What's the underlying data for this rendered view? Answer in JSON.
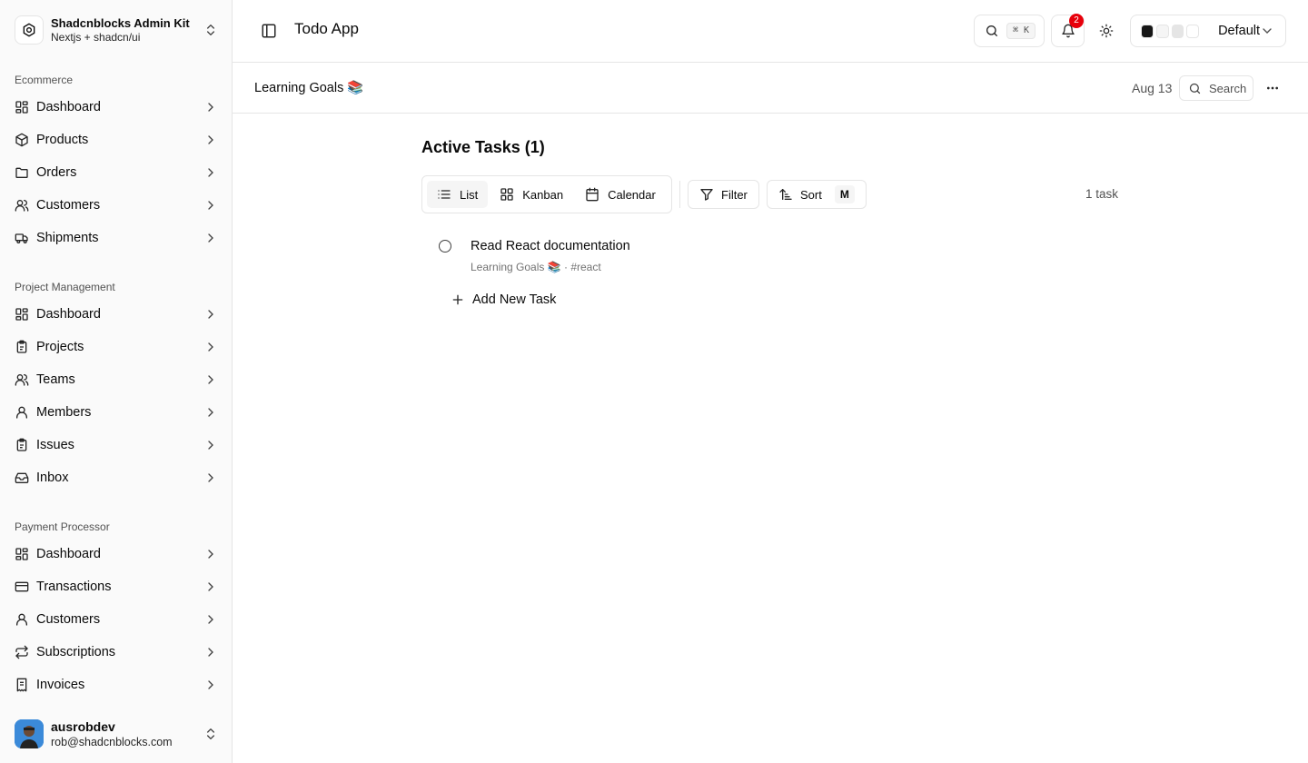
{
  "brand": {
    "name": "Shadcnblocks Admin Kit",
    "subtitle": "Nextjs + shadcn/ui"
  },
  "sidebar": {
    "groups": [
      {
        "title": "Ecommerce",
        "items": [
          {
            "label": "Dashboard",
            "icon": "dashboard-icon"
          },
          {
            "label": "Products",
            "icon": "package-icon"
          },
          {
            "label": "Orders",
            "icon": "folder-icon"
          },
          {
            "label": "Customers",
            "icon": "users-icon"
          },
          {
            "label": "Shipments",
            "icon": "truck-icon"
          }
        ]
      },
      {
        "title": "Project Management",
        "items": [
          {
            "label": "Dashboard",
            "icon": "dashboard-icon"
          },
          {
            "label": "Projects",
            "icon": "clipboard-icon"
          },
          {
            "label": "Teams",
            "icon": "users-icon"
          },
          {
            "label": "Members",
            "icon": "user-icon"
          },
          {
            "label": "Issues",
            "icon": "clipboard-icon"
          },
          {
            "label": "Inbox",
            "icon": "inbox-icon"
          }
        ]
      },
      {
        "title": "Payment Processor",
        "items": [
          {
            "label": "Dashboard",
            "icon": "dashboard-icon"
          },
          {
            "label": "Transactions",
            "icon": "credit-card-icon"
          },
          {
            "label": "Customers",
            "icon": "user-icon"
          },
          {
            "label": "Subscriptions",
            "icon": "repeat-icon"
          },
          {
            "label": "Invoices",
            "icon": "receipt-icon"
          }
        ]
      }
    ]
  },
  "user": {
    "name": "ausrobdev",
    "email": "rob@shadcnblocks.com"
  },
  "header": {
    "title": "Todo App",
    "search_shortcut": "⌘ K",
    "notification_count": "2",
    "theme_label": "Default",
    "theme_swatches": [
      "#171717",
      "#f5f5f5",
      "#e5e5e5",
      "#ffffff"
    ]
  },
  "subheader": {
    "project": "Learning Goals 📚",
    "date": "Aug 13",
    "search_label": "Search"
  },
  "main": {
    "title": "Active Tasks (1)",
    "views": [
      {
        "label": "List",
        "icon": "list-icon",
        "active": true
      },
      {
        "label": "Kanban",
        "icon": "kanban-icon",
        "active": false
      },
      {
        "label": "Calendar",
        "icon": "calendar-icon",
        "active": false
      }
    ],
    "filter_label": "Filter",
    "sort_label": "Sort",
    "sort_kbd": "M",
    "task_count": "1 task",
    "tasks": [
      {
        "title": "Read React documentation",
        "meta": "Learning Goals 📚 · #react"
      }
    ],
    "add_task_label": "Add New Task"
  }
}
